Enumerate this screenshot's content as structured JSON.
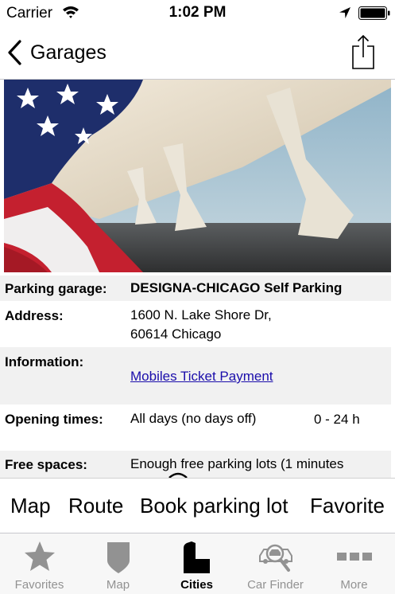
{
  "status_bar": {
    "carrier": "Carrier",
    "time": "1:02 PM"
  },
  "nav": {
    "back_label": "Garages"
  },
  "details": {
    "parking_garage": {
      "label": "Parking garage:",
      "value": "DESIGNA-CHICAGO Self Parking"
    },
    "address": {
      "label": "Address:",
      "line1": "1600 N. Lake Shore Dr,",
      "line2": "60614 Chicago"
    },
    "information": {
      "label": "Information:",
      "link": "Mobiles Ticket Payment"
    },
    "opening_times": {
      "label": "Opening times:",
      "value": "All days (no days off)",
      "hours": "0 - 24 h"
    },
    "free_spaces": {
      "label": "Free spaces:",
      "value": "Enough free parking lots (1 minutes"
    }
  },
  "actions": {
    "map": "Map",
    "route": "Route",
    "book": "Book parking lot",
    "favorite": "Favorite"
  },
  "tabs": [
    {
      "label": "Favorites",
      "icon": "star-icon",
      "active": false
    },
    {
      "label": "Map",
      "icon": "pin-icon",
      "active": false
    },
    {
      "label": "Cities",
      "icon": "city-icon",
      "active": true
    },
    {
      "label": "Car Finder",
      "icon": "car-finder-icon",
      "active": false
    },
    {
      "label": "More",
      "icon": "more-icon",
      "active": false
    }
  ],
  "colors": {
    "link": "#1a0dab",
    "row_shade": "#f1f1f1",
    "tab_inactive": "#929292",
    "tab_active": "#000000"
  }
}
